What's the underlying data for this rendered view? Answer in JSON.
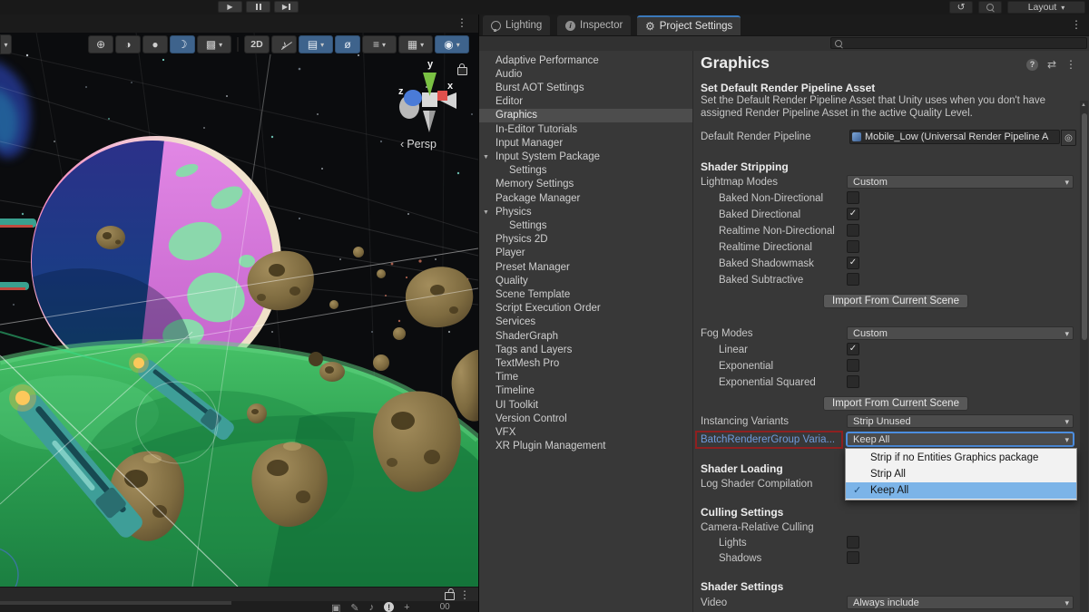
{
  "colors": {
    "accent_blue": "#3a79bb",
    "selection_blue": "#7cb4e8",
    "link_blue": "#6f9bdc",
    "warning_red": "#8e2020",
    "active_btn_blue": "#3e638c"
  },
  "icons": {
    "kebab": "⋮",
    "dd_arrow": "▾",
    "foldout": "▼",
    "check": "✓",
    "play": "▶",
    "history": "↺",
    "picker": "◎",
    "preset": "⇄",
    "help": "?",
    "info": "i",
    "gear": "⚙",
    "persp_arrow": "‹",
    "draw_shaded": "⊕",
    "draw_half": "◑",
    "draw_solid": "●",
    "draw_wire": "☽",
    "fx": "▩",
    "audio": "♪",
    "layers_a": "▤",
    "eye": "ø",
    "layers_b": "≡",
    "camera": "▦",
    "gizmo": "◉",
    "up_arrow": "▲",
    "bs_1": "▣",
    "bs_2": "✎",
    "bs_3": "♪",
    "bs_4": "!",
    "bs_5": "+",
    "bs_count": "00"
  },
  "toolbar": {
    "layout_label": "Layout"
  },
  "scene": {
    "persp_label": "Persp",
    "mode_2d": "2D",
    "axis_x": "x",
    "axis_y": "y",
    "axis_z": "z"
  },
  "tabs": [
    {
      "label": "Lighting"
    },
    {
      "label": "Inspector"
    },
    {
      "label": "Project Settings"
    }
  ],
  "search": {
    "placeholder": ""
  },
  "settings_list": {
    "items": [
      "Adaptive Performance",
      "Audio",
      "Burst AOT Settings",
      "Editor",
      "Graphics",
      "In-Editor Tutorials",
      "Input Manager",
      "Input System Package",
      "Settings",
      "Memory Settings",
      "Package Manager",
      "Physics",
      "Settings",
      "Physics 2D",
      "Player",
      "Preset Manager",
      "Quality",
      "Scene Template",
      "Script Execution Order",
      "Services",
      "ShaderGraph",
      "Tags and Layers",
      "TextMesh Pro",
      "Time",
      "Timeline",
      "UI Toolkit",
      "Version Control",
      "VFX",
      "XR Plugin Management"
    ]
  },
  "graphics": {
    "title": "Graphics",
    "pipeline": {
      "header": "Set Default Render Pipeline Asset",
      "desc": "Set the Default Render Pipeline Asset that Unity uses when you don't have assigned Render Pipeline Asset in the active Quality Level.",
      "label": "Default Render Pipeline",
      "value": "Mobile_Low (Universal Render Pipeline A"
    },
    "stripping": {
      "header": "Shader Stripping",
      "lightmap_label": "Lightmap Modes",
      "lightmap_value": "Custom",
      "checks": [
        {
          "label": "Baked Non-Directional",
          "check": ""
        },
        {
          "label": "Baked Directional",
          "check": "✓"
        },
        {
          "label": "Realtime Non-Directional",
          "check": ""
        },
        {
          "label": "Realtime Directional",
          "check": ""
        },
        {
          "label": "Baked Shadowmask",
          "check": "✓"
        },
        {
          "label": "Baked Subtractive",
          "check": ""
        }
      ],
      "import_button": "Import From Current Scene",
      "fog_label": "Fog Modes",
      "fog_value": "Custom",
      "fog_checks": [
        {
          "label": "Linear",
          "check": "✓"
        },
        {
          "label": "Exponential",
          "check": ""
        },
        {
          "label": "Exponential Squared",
          "check": ""
        }
      ],
      "import_button2": "Import From Current Scene",
      "instancing_label": "Instancing Variants",
      "instancing_value": "Strip Unused",
      "brg_label": "BatchRendererGroup Varia...",
      "brg_value": "Keep All"
    },
    "menu": {
      "items": [
        {
          "label": "Strip if no Entities Graphics package",
          "check": ""
        },
        {
          "label": "Strip All",
          "check": ""
        },
        {
          "label": "Keep All",
          "check": "✓"
        }
      ]
    },
    "loading": {
      "header": "Shader Loading",
      "log_label": "Log Shader Compilation"
    },
    "culling": {
      "header": "Culling Settings",
      "camera_label": "Camera-Relative Culling",
      "lights_label": "Lights",
      "shadows_label": "Shadows"
    },
    "shader_settings": {
      "header": "Shader Settings",
      "video_label": "Video",
      "video_value": "Always include"
    }
  }
}
